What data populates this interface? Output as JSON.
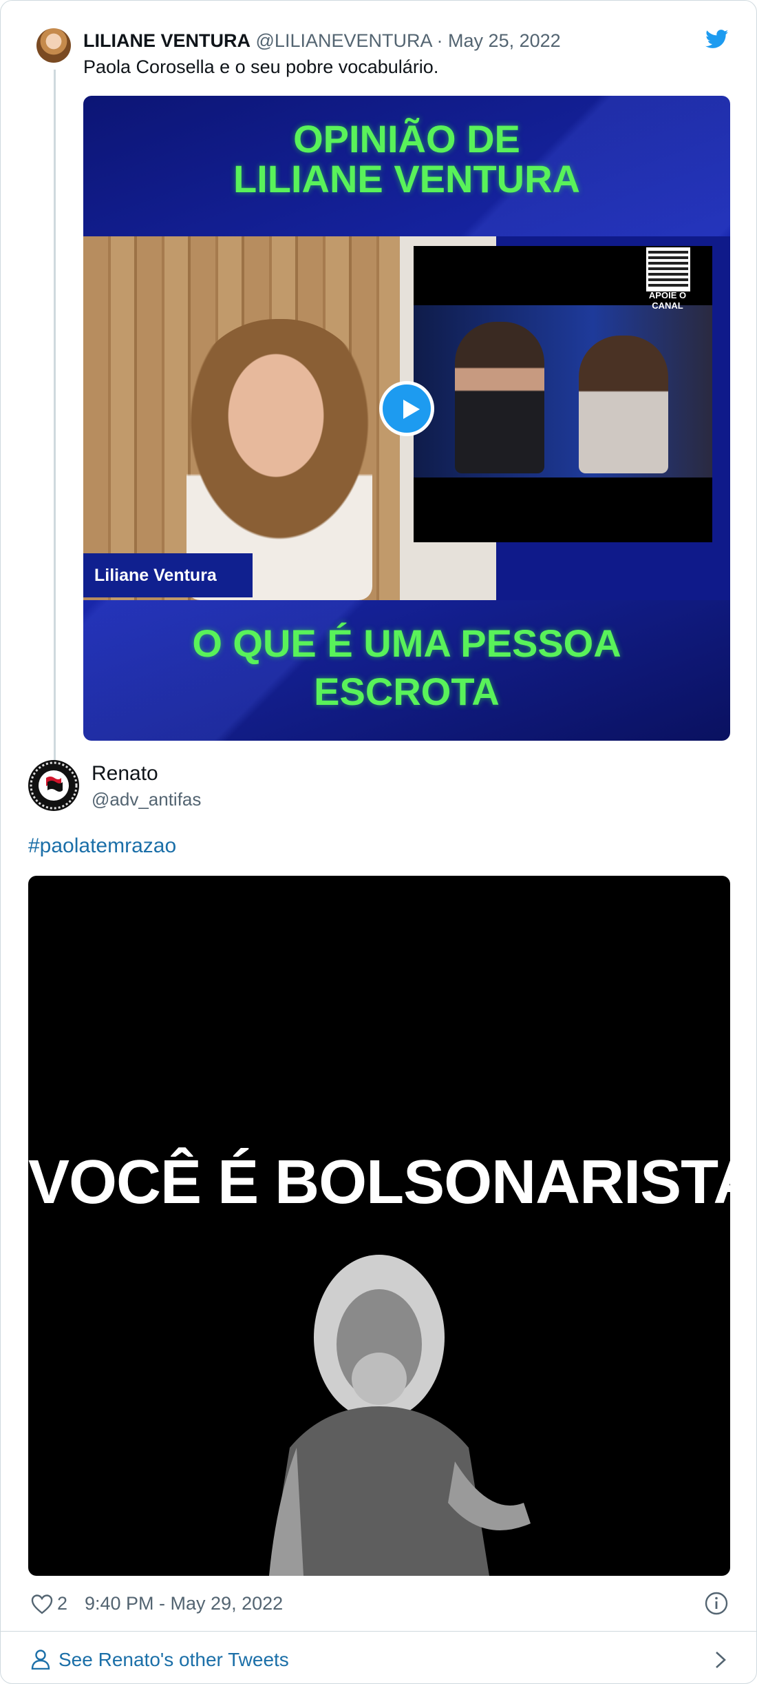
{
  "parent_tweet": {
    "name": "LILIANE VENTURA",
    "handle": "@LILIANEVENTURA",
    "separator": "·",
    "date": "May 25, 2022",
    "text": "Paola Corosella e o seu pobre vocabulário.",
    "video": {
      "title_line1": "OPINIÃO DE",
      "title_line2": "LILIANE VENTURA",
      "name_tag": "Liliane Ventura",
      "qr_label_line1": "APOIE O",
      "qr_label_line2": "CANAL",
      "caption_line1": "O QUE É UMA PESSOA",
      "caption_line2": "ESCROTA"
    }
  },
  "tweet": {
    "name": "Renato",
    "handle": "@adv_antifas",
    "hashtag": "#paolatemrazao",
    "image_text": "VOCÊ É BOLSONARISTA?",
    "like_count": "2",
    "timestamp": "9:40 PM - May 29, 2022"
  },
  "footer": {
    "see_more": "See Renato's other Tweets"
  },
  "icons": {
    "brand": "twitter-bird-icon",
    "like": "heart-outline-icon",
    "info": "info-circle-icon",
    "profile": "person-outline-icon",
    "more": "chevron-right-icon",
    "play": "play-icon"
  },
  "colors": {
    "twitter_blue": "#1d9bf0",
    "link_blue": "#1b6fa8",
    "secondary_text": "#536471",
    "video_green_text": "#59f25a",
    "border": "#cfd9de"
  }
}
